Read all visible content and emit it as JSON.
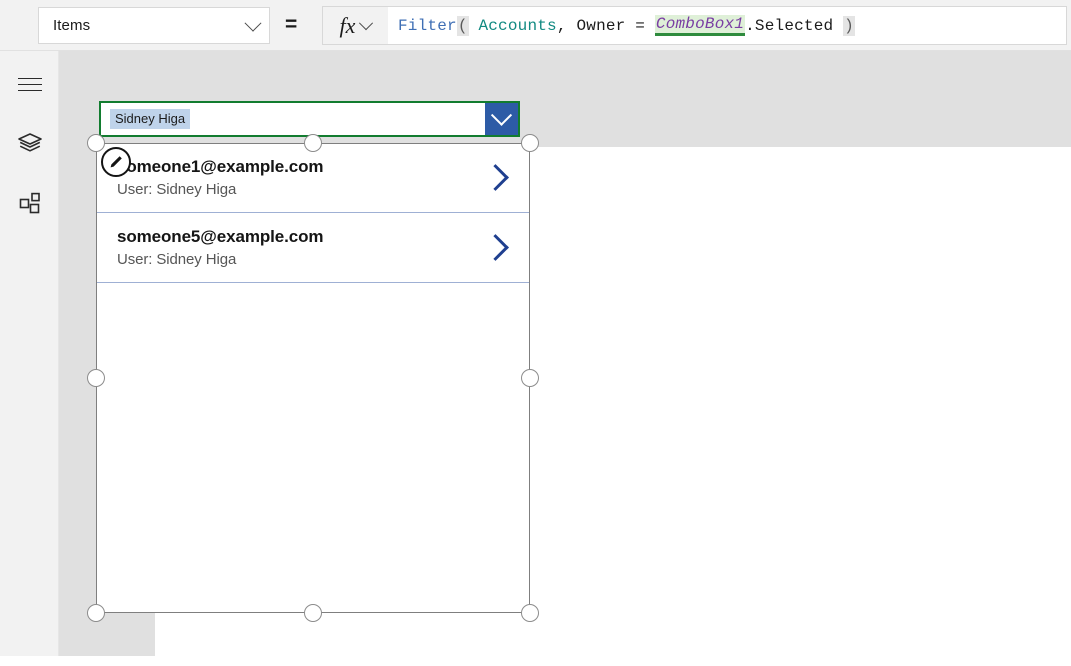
{
  "formula_bar": {
    "property_dropdown": {
      "value": "Items",
      "chevron_icon": "chevron-down-icon"
    },
    "equals": "=",
    "fx_button": {
      "glyph": "fx",
      "chevron_icon": "chevron-down-icon"
    },
    "formula_tokens": [
      {
        "text": "Filter",
        "type": "function"
      },
      {
        "text": "(",
        "type": "paren-match"
      },
      {
        "text": " ",
        "type": "plain"
      },
      {
        "text": "Accounts",
        "type": "table"
      },
      {
        "text": ", ",
        "type": "plain"
      },
      {
        "text": "Owner",
        "type": "identifier"
      },
      {
        "text": " = ",
        "type": "operator"
      },
      {
        "text": "ComboBox1",
        "type": "control-reference"
      },
      {
        "text": ".Selected ",
        "type": "identifier"
      },
      {
        "text": ")",
        "type": "paren-match"
      }
    ],
    "formula_plain": "Filter( Accounts, Owner = ComboBox1.Selected )"
  },
  "left_rail": {
    "items": [
      {
        "name": "hamburger-menu",
        "icon": "hamburger-icon"
      },
      {
        "name": "tree-view",
        "icon": "layers-icon"
      },
      {
        "name": "insert",
        "icon": "insert-components-icon"
      }
    ]
  },
  "canvas": {
    "combobox": {
      "selected_chip": "Sidney Higa",
      "dropdown_icon": "chevron-down-icon"
    },
    "gallery": {
      "items": [
        {
          "title": "someone1@example.com",
          "subtitle": "User: Sidney Higa",
          "chevron_icon": "chevron-right-icon"
        },
        {
          "title": "someone5@example.com",
          "subtitle": "User: Sidney Higa",
          "chevron_icon": "chevron-right-icon"
        }
      ],
      "edit_badge_icon": "pencil-edit-icon"
    }
  },
  "colors": {
    "selection_green": "#127c2f",
    "combobox_button_blue": "#2d5ba6",
    "chip_blue": "#bfd3ea",
    "gallery_chevron_navy": "#1f3f8f",
    "gallery_separator": "#9fb0d4",
    "formula_function_blue": "#3f6fb5",
    "formula_table_teal": "#128a82",
    "formula_control_purple": "#7a3ea3",
    "canvas_backdrop": "#e0e0e0"
  }
}
